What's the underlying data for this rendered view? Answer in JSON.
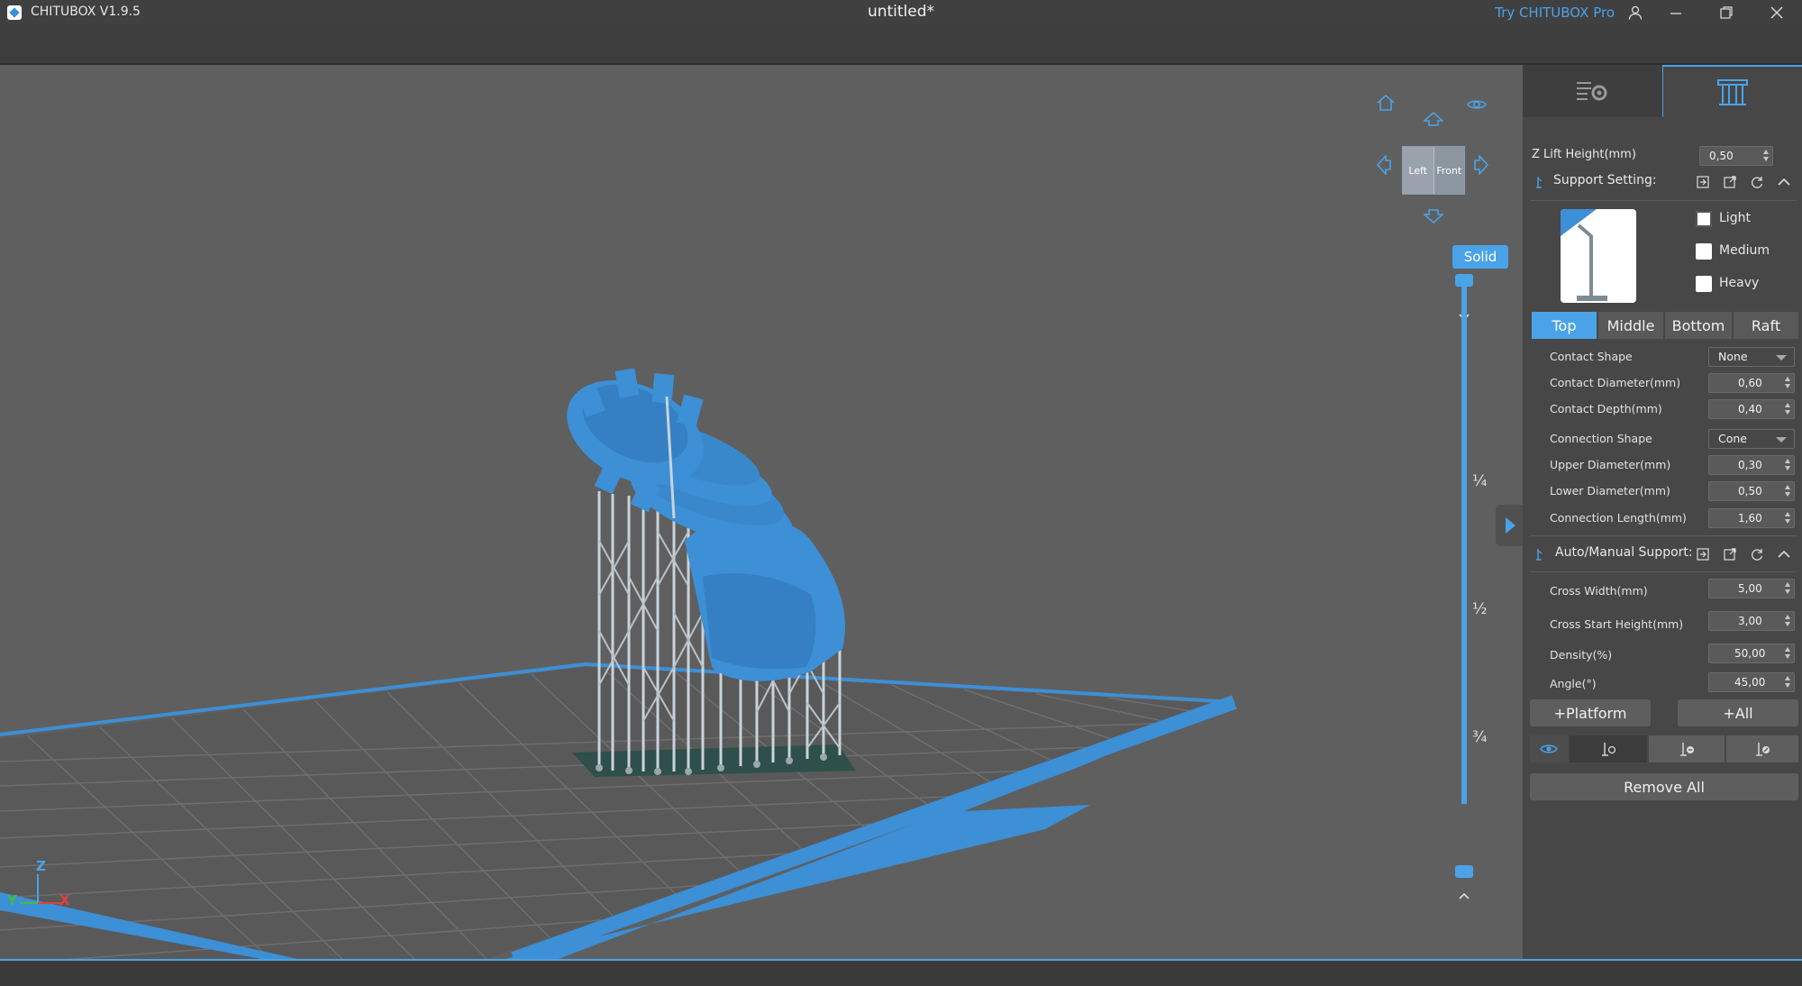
{
  "app": {
    "name": "CHITUBOX V1.9.5",
    "document_title": "untitled*",
    "try_pro": "Try CHITUBOX Pro"
  },
  "viewport": {
    "view_cube": {
      "left": "Left",
      "front": "Front"
    },
    "render_mode": "Solid",
    "slider_marks": [
      "¼",
      "½",
      "¾"
    ],
    "axes": {
      "z": "Z",
      "y": "Y",
      "x": "X"
    },
    "colors": {
      "accent": "#4aa3e8",
      "model": "#3d8fd6",
      "supports": "#c8d2d8",
      "background": "#5f5f5f"
    }
  },
  "panel": {
    "z_lift": {
      "label": "Z Lift Height(mm)",
      "value": "0,50"
    },
    "support_setting": {
      "title": "Support Setting:",
      "presets": [
        {
          "label": "Light",
          "checked": true
        },
        {
          "label": "Medium",
          "checked": false
        },
        {
          "label": "Heavy",
          "checked": false
        }
      ],
      "tabs": [
        "Top",
        "Middle",
        "Bottom",
        "Raft"
      ],
      "active_tab": "Top",
      "fields": {
        "contact_shape": {
          "label": "Contact Shape",
          "value": "None"
        },
        "contact_diameter": {
          "label": "Contact Diameter(mm)",
          "value": "0,60"
        },
        "contact_depth": {
          "label": "Contact Depth(mm)",
          "value": "0,40"
        },
        "connection_shape": {
          "label": "Connection Shape",
          "value": "Cone"
        },
        "upper_diameter": {
          "label": "Upper Diameter(mm)",
          "value": "0,30"
        },
        "lower_diameter": {
          "label": "Lower Diameter(mm)",
          "value": "0,50"
        },
        "connection_length": {
          "label": "Connection Length(mm)",
          "value": "1,60"
        }
      }
    },
    "auto_manual": {
      "title": "Auto/Manual Support:",
      "fields": {
        "cross_width": {
          "label": "Cross Width(mm)",
          "value": "5,00"
        },
        "cross_start": {
          "label": "Cross Start Height(mm)",
          "value": "3,00"
        },
        "density": {
          "label": "Density(%)",
          "value": "50,00"
        },
        "angle": {
          "label": "Angle(°)",
          "value": "45,00"
        }
      },
      "platform_button": "+Platform",
      "all_button": "+All",
      "remove_all_button": "Remove All"
    }
  }
}
